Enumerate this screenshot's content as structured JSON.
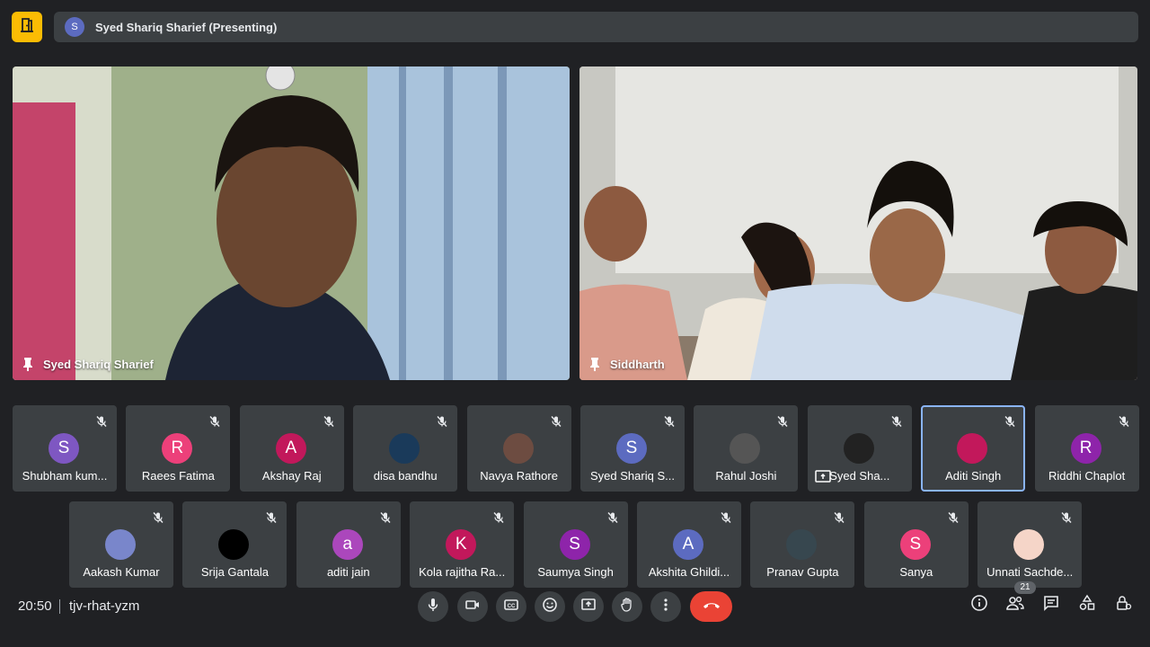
{
  "presenting": {
    "avatar_letter": "S",
    "label": "Syed Shariq Sharief (Presenting)"
  },
  "main_tiles": [
    {
      "name": "Syed Shariq Sharief"
    },
    {
      "name": "Siddharth"
    }
  ],
  "row1": [
    {
      "name": "Shubham kum...",
      "letter": "S",
      "color": "#7e57c2"
    },
    {
      "name": "Raees Fatima",
      "letter": "R",
      "color": "#ec407a"
    },
    {
      "name": "Akshay Raj",
      "letter": "A",
      "color": "#c2185b"
    },
    {
      "name": "disa bandhu",
      "letter": "",
      "color": "#1a3a5a"
    },
    {
      "name": "Navya Rathore",
      "letter": "",
      "color": "#6d4c41"
    },
    {
      "name": "Syed Shariq S...",
      "letter": "S",
      "color": "#5c6bc0"
    },
    {
      "name": "Rahul Joshi",
      "letter": "",
      "color": "#555"
    },
    {
      "name": "Syed Sha...",
      "letter": "",
      "color": "#222"
    },
    {
      "name": "Aditi Singh",
      "letter": "",
      "color": "#c2185b"
    },
    {
      "name": "Riddhi Chaplot",
      "letter": "R",
      "color": "#8e24aa"
    }
  ],
  "row2": [
    {
      "name": "Aakash Kumar",
      "letter": "",
      "color": "#7986cb"
    },
    {
      "name": "Srija Gantala",
      "letter": "",
      "color": "#000000"
    },
    {
      "name": "aditi jain",
      "letter": "a",
      "color": "#ab47bc"
    },
    {
      "name": "Kola rajitha Ra...",
      "letter": "K",
      "color": "#c2185b"
    },
    {
      "name": "Saumya Singh",
      "letter": "S",
      "color": "#8e24aa"
    },
    {
      "name": "Akshita Ghildi...",
      "letter": "A",
      "color": "#5c6bc0"
    },
    {
      "name": "Pranav Gupta",
      "letter": "",
      "color": "#37474f"
    },
    {
      "name": "Sanya",
      "letter": "S",
      "color": "#ec407a"
    },
    {
      "name": "Unnati Sachde...",
      "letter": "",
      "color": "#f5d5c8"
    }
  ],
  "bottom": {
    "time": "20:50",
    "meeting_code": "tjv-rhat-yzm",
    "participant_count": "21"
  },
  "icons": {
    "logo": "door-icon",
    "mic": "mic-icon",
    "camera": "camera-icon",
    "captions": "captions-icon",
    "emoji": "emoji-icon",
    "present": "present-icon",
    "hand": "raise-hand-icon",
    "more": "more-vert-icon",
    "hangup": "hangup-icon",
    "info": "info-icon",
    "people": "people-icon",
    "chat": "chat-icon",
    "activities": "activities-icon",
    "host": "host-controls-icon"
  }
}
